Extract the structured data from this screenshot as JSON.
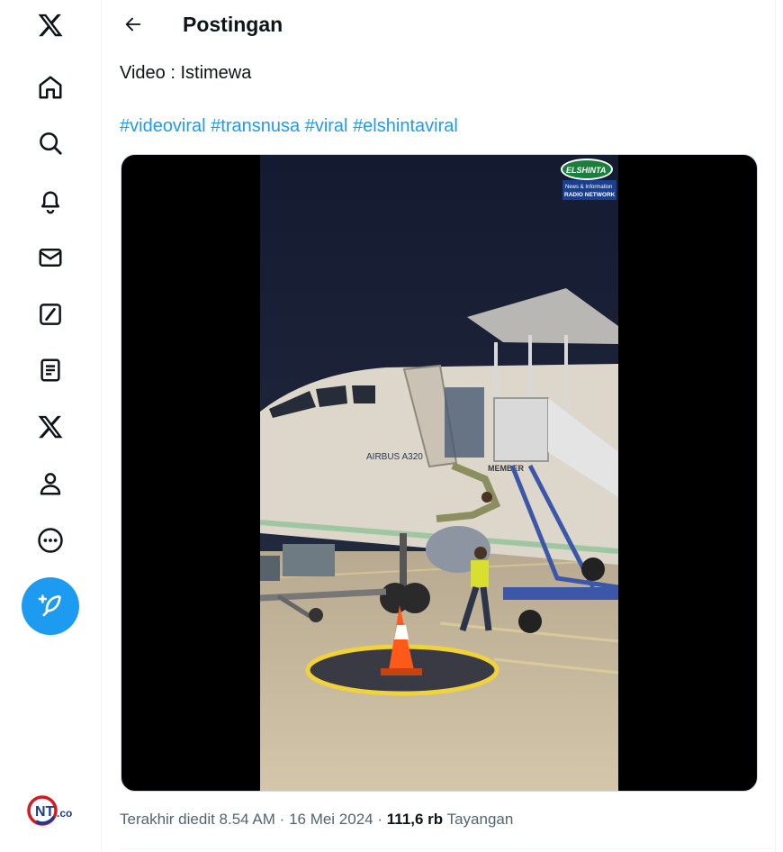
{
  "sidebar": {
    "items": [
      {
        "icon": "x-logo-icon"
      },
      {
        "icon": "home-icon"
      },
      {
        "icon": "search-icon"
      },
      {
        "icon": "bell-icon"
      },
      {
        "icon": "mail-icon"
      },
      {
        "icon": "grok-icon"
      },
      {
        "icon": "lists-icon"
      },
      {
        "icon": "x-premium-icon"
      },
      {
        "icon": "profile-icon"
      },
      {
        "icon": "more-icon"
      }
    ],
    "compose_icon": "compose-feather-icon",
    "watermark": {
      "text": "NT.co",
      "icon": "ntco-logo"
    }
  },
  "header": {
    "title": "Postingan",
    "back_icon": "arrow-left-icon"
  },
  "post": {
    "text": "Video : Istimewa",
    "hashtags": [
      "#videoviral",
      "#transnusa",
      "#viral",
      "#elshintaviral"
    ],
    "media": {
      "type": "video",
      "overlay_logo": {
        "name": "ELSHINTA",
        "line1": "News & Information",
        "line2": "RADIO NETWORK"
      },
      "aircraft_text": "AIRBUS A320",
      "stair_text": "MEMBER"
    },
    "meta": {
      "edited": "Terakhir diedit 8.54 AM",
      "separator": "·",
      "date": "16 Mei 2024",
      "views_count": "111,6 rb",
      "views_label": "Tayangan"
    }
  },
  "colors": {
    "accent": "#1d9bf0",
    "text": "#0f1419",
    "secondary": "#536471"
  }
}
